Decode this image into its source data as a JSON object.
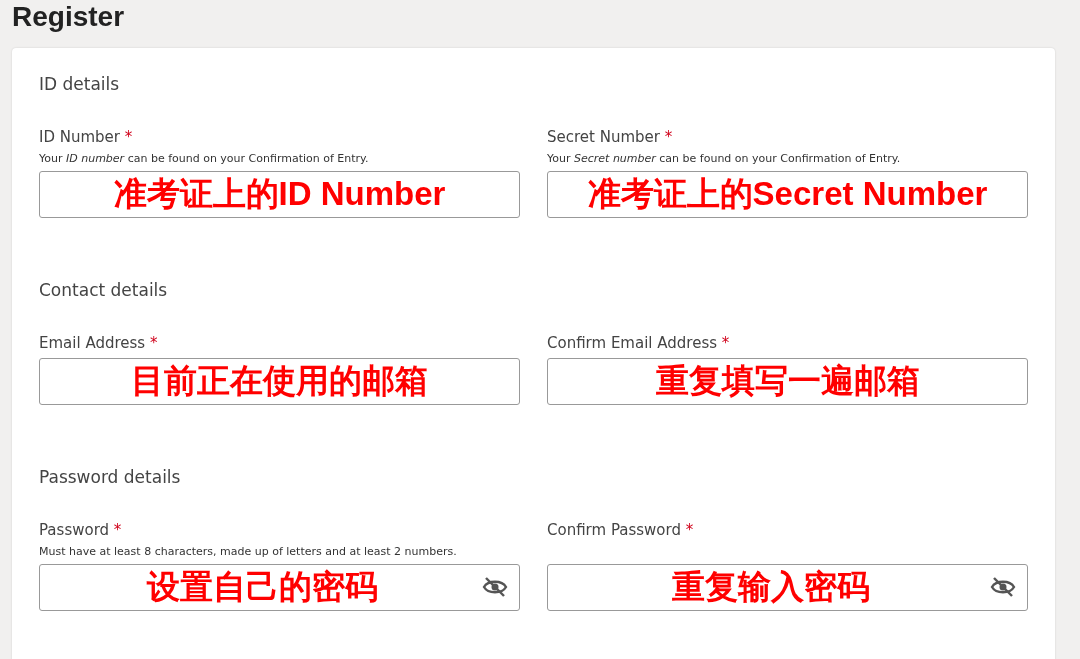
{
  "page_title": "Register",
  "sections": [
    {
      "heading": "ID details",
      "fields": [
        {
          "label": "ID Number",
          "required_mark": "*",
          "hint": "Your *ID number* can be found on your Confirmation of Entry.",
          "value": "准考证上的ID Number",
          "kind": "text"
        },
        {
          "label": "Secret Number",
          "required_mark": "*",
          "hint": "Your *Secret number* can be found on your Confirmation of Entry.",
          "value": "准考证上的Secret Number",
          "kind": "text"
        }
      ]
    },
    {
      "heading": "Contact details",
      "fields": [
        {
          "label": "Email Address",
          "required_mark": "*",
          "value": "目前正在使用的邮箱",
          "kind": "text"
        },
        {
          "label": "Confirm Email Address",
          "required_mark": "*",
          "value": "重复填写一遍邮箱",
          "kind": "text"
        }
      ]
    },
    {
      "heading": "Password details",
      "fields": [
        {
          "label": "Password",
          "required_mark": "*",
          "hint": "Must have at least 8 characters, made up of letters and at least 2 numbers.",
          "value": "设置自己的密码",
          "kind": "password"
        },
        {
          "label": "Confirm Password",
          "required_mark": "*",
          "value": "重复输入密码",
          "kind": "password"
        }
      ]
    }
  ]
}
